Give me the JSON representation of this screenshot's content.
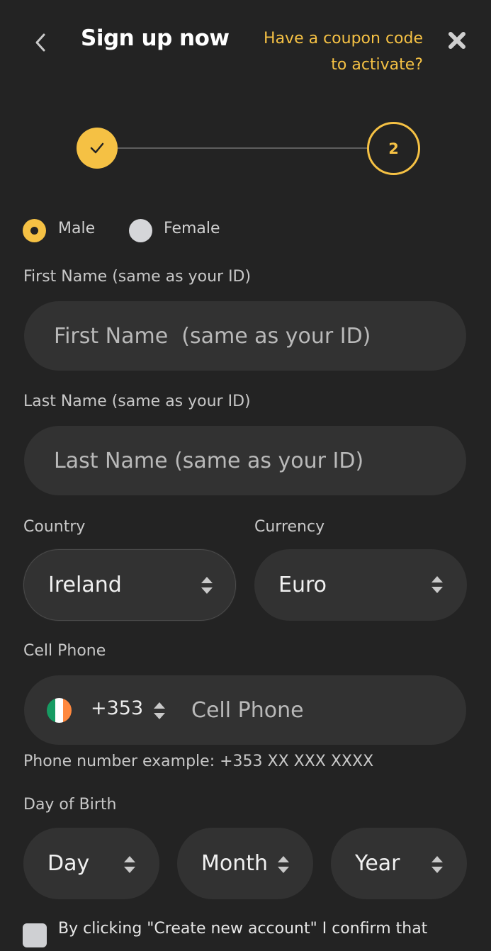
{
  "header": {
    "title": "Sign up now",
    "coupon_line1": "Have a coupon code",
    "coupon_line2": "to activate?"
  },
  "stepper": {
    "step2_label": "2"
  },
  "gender": {
    "male": "Male",
    "female": "Female",
    "selected": "Male"
  },
  "first_name": {
    "label": "First Name (same as your ID)",
    "placeholder": "First Name  (same as your ID)"
  },
  "last_name": {
    "label": "Last Name (same as your ID)",
    "placeholder": "Last Name (same as your ID)"
  },
  "country": {
    "label": "Country",
    "value": "Ireland"
  },
  "currency": {
    "label": "Currency",
    "value": "Euro"
  },
  "phone": {
    "label": "Cell Phone",
    "dial_code": "+353",
    "placeholder": "Cell Phone",
    "example": "Phone number example: +353 XX XXX XXXX"
  },
  "birth": {
    "label": "Day of Birth",
    "day": "Day",
    "month": "Month",
    "year": "Year"
  },
  "consent": {
    "text": "By clicking \"Create new account\" I confirm that"
  },
  "colors": {
    "accent": "#f5c144",
    "background": "#232323",
    "field": "#323232"
  }
}
